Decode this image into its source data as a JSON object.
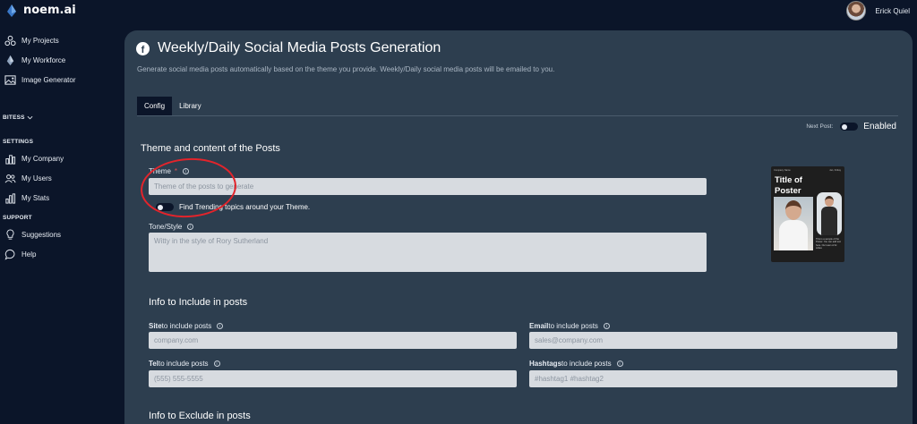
{
  "app": {
    "brand": "noem.ai"
  },
  "user": {
    "name": "Erick Quiel"
  },
  "sidebar": {
    "items": [
      {
        "label": "My Projects",
        "icon": "projects-icon"
      },
      {
        "label": "My Workforce",
        "icon": "workforce-icon"
      },
      {
        "label": "Image Generator",
        "icon": "image-icon"
      }
    ],
    "bitess_label": "BITESS",
    "settings_label": "SETTINGS",
    "settings_items": [
      {
        "label": "My Company",
        "icon": "company-icon"
      },
      {
        "label": "My Users",
        "icon": "users-icon"
      },
      {
        "label": "My Stats",
        "icon": "stats-icon"
      }
    ],
    "support_label": "SUPPORT",
    "support_items": [
      {
        "label": "Suggestions",
        "icon": "lightbulb-icon"
      },
      {
        "label": "Help",
        "icon": "help-chat-icon"
      }
    ]
  },
  "page": {
    "title": "Weekly/Daily Social Media Posts Generation",
    "subtitle": "Generate social media posts automatically based on the theme you provide. Weekly/Daily social media posts will be emailed to you.",
    "tabs": [
      "Config",
      "Library"
    ],
    "active_tab": "Config",
    "next_post": {
      "label": "Next Post:",
      "value": "Enabled"
    }
  },
  "theme_section": {
    "title": "Theme and content of the Posts",
    "theme_label": "Theme",
    "required_mark": "*",
    "theme_placeholder": "Theme of the posts to generate",
    "trending_label": "Find Trending topics around your Theme.",
    "tone_label": "Tone/Style",
    "tone_placeholder": "Witty in the style of Rory Sutherland"
  },
  "poster": {
    "brand_small": "Company Name",
    "date_small": "Jan, Friday",
    "title_line1": "Title of",
    "title_line2": "Poster",
    "text": "This is a sample of the Poster. You can add text here. Our team of AI writes"
  },
  "include_section": {
    "title": "Info to Include in posts",
    "site": {
      "label_bold": "Site",
      "label_rest": " to include posts",
      "placeholder": "company.com"
    },
    "email": {
      "label_bold": "Email",
      "label_rest": " to include posts",
      "placeholder": "sales@company.com"
    },
    "tel": {
      "label_bold": "Tel",
      "label_rest": " to include posts",
      "placeholder": "(555) 555-5555"
    },
    "hashtags": {
      "label_bold": "Hashtags",
      "label_rest": " to include posts",
      "placeholder": "#hashtag1 #hashtag2"
    }
  },
  "exclude_section": {
    "title": "Info to Exclude in posts"
  },
  "colors": {
    "background": "#0b1529",
    "panel": "#2d3e4f",
    "annotation": "#e3242b",
    "input": "#d7dbe0"
  }
}
